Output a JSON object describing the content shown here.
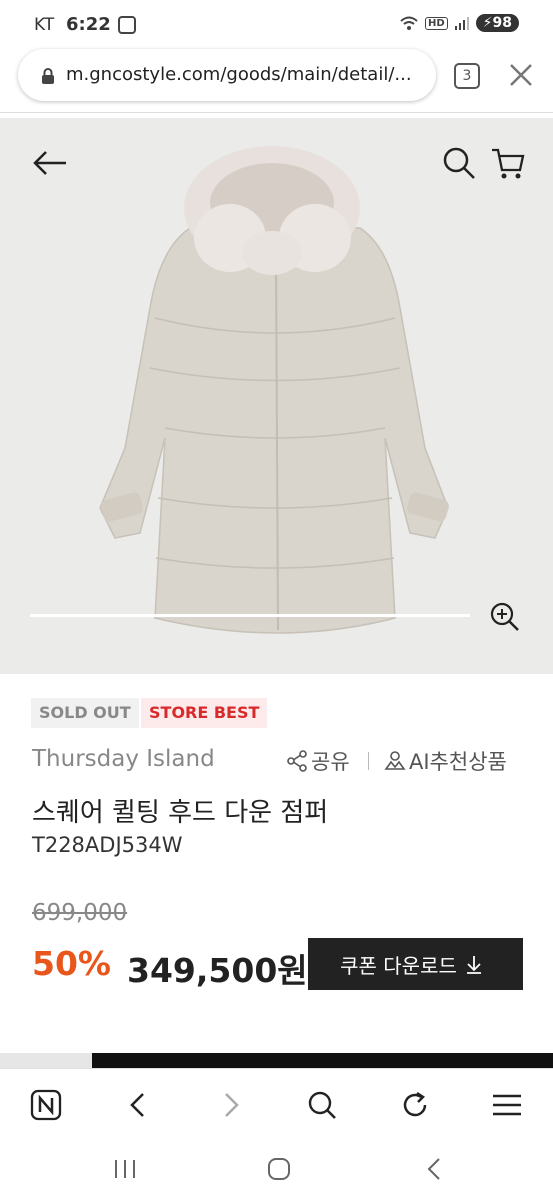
{
  "status_bar": {
    "carrier": "KT",
    "time": "6:22",
    "hd": "HD",
    "battery": "98"
  },
  "browser": {
    "url": "m.gncostyle.com/goods/main/detail/...",
    "tab_count": "3"
  },
  "product": {
    "badges": {
      "sold_out": "SOLD OUT",
      "store_best": "STORE BEST"
    },
    "brand": "Thursday Island",
    "share_label": "공유",
    "ai_recommend_label": "AI추천상품",
    "title": "스퀘어 퀼팅 후드 다운 점퍼",
    "code": "T228ADJ534W",
    "original_price": "699,000",
    "discount": "50%",
    "sale_price": "349,500원",
    "coupon_button": "쿠폰 다운로드"
  },
  "icons": {
    "back": "back-arrow-icon",
    "search": "search-icon",
    "cart": "cart-icon",
    "zoom": "zoom-in-icon",
    "share": "share-icon",
    "ai": "ai-recommend-icon",
    "download": "download-icon"
  },
  "colors": {
    "discount": "#e8561c",
    "best_badge": "#d72b2b",
    "coupon_bg": "#222222"
  }
}
